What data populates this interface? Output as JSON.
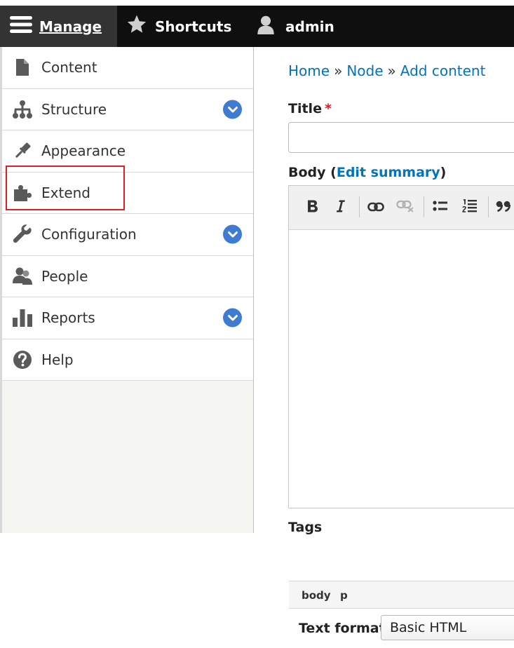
{
  "toolbar": {
    "manage_label": "Manage",
    "shortcuts_label": "Shortcuts",
    "admin_label": "admin"
  },
  "menu": {
    "items": [
      {
        "label": "Content",
        "icon": "file-icon",
        "expandable": false
      },
      {
        "label": "Structure",
        "icon": "sitemap-icon",
        "expandable": true
      },
      {
        "label": "Appearance",
        "icon": "paint-brush-icon",
        "expandable": false
      },
      {
        "label": "Extend",
        "icon": "puzzle-icon",
        "expandable": false
      },
      {
        "label": "Configuration",
        "icon": "wrench-icon",
        "expandable": true
      },
      {
        "label": "People",
        "icon": "people-icon",
        "expandable": false
      },
      {
        "label": "Reports",
        "icon": "bar-chart-icon",
        "expandable": true
      },
      {
        "label": "Help",
        "icon": "help-icon",
        "expandable": false
      }
    ]
  },
  "breadcrumb": {
    "home": "Home",
    "node": "Node",
    "add_content": "Add content",
    "separator": "»"
  },
  "form": {
    "title_label": "Title",
    "required_mark": "*",
    "title_value": "",
    "body_label": "Body",
    "body_paren_open": "(",
    "edit_summary": "Edit summary",
    "body_paren_close": ")",
    "element_path": [
      "body",
      "p"
    ],
    "text_format_label": "Text format",
    "text_format_value": "Basic HTML",
    "tags_label": "Tags"
  },
  "colors": {
    "toolbar_bg": "#0f0f0f",
    "manage_bg": "#333333",
    "link": "#0074bd",
    "toggle": "#3f7bd1",
    "required": "#e01e24",
    "highlight_box": "#e01e24"
  }
}
